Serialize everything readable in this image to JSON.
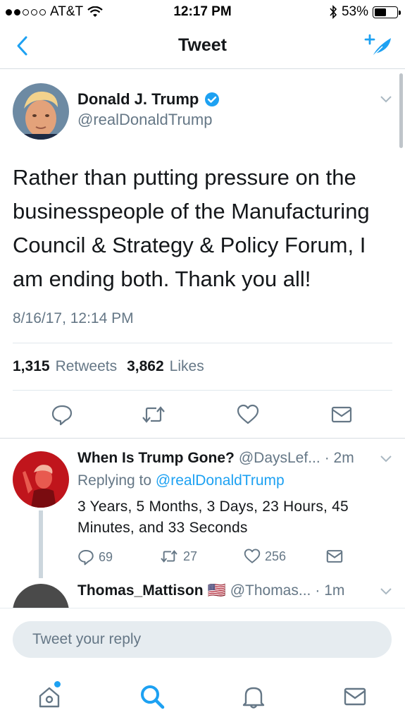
{
  "status_bar": {
    "carrier": "AT&T",
    "time": "12:17 PM",
    "battery_percent": "53%",
    "battery_level": 0.53
  },
  "nav": {
    "title": "Tweet"
  },
  "tweet": {
    "author_name": "Donald J. Trump",
    "author_handle": "@realDonaldTrump",
    "text": "Rather than putting pressure on the businesspeople of the Manufacturing Council & Strategy & Policy Forum, I am ending both. Thank you all!",
    "timestamp": "8/16/17, 12:14 PM",
    "retweets_count": "1,315",
    "retweets_label": "Retweets",
    "likes_count": "3,862",
    "likes_label": "Likes"
  },
  "replies": [
    {
      "name": "When Is Trump Gone?",
      "handle": "@DaysLef...",
      "age": "· 2m",
      "replying_prefix": "Replying to",
      "replying_to": "@realDonaldTrump",
      "text": "3 Years, 5 Months, 3 Days, 23 Hours, 45 Minutes, and 33 Seconds",
      "reply_count": "69",
      "retweet_count": "27",
      "like_count": "256"
    },
    {
      "name": "Thomas_Mattison",
      "flag": "🇺🇸",
      "handle": "@Thomas...",
      "age": "· 1m"
    }
  ],
  "composer": {
    "placeholder": "Tweet your reply"
  },
  "colors": {
    "accent": "#1da1f2",
    "secondary_text": "#657786",
    "primary_text": "#14171a"
  },
  "icons": [
    "back-chevron-icon",
    "compose-icon",
    "verified-icon",
    "chevron-down-icon",
    "reply-icon",
    "retweet-icon",
    "like-icon",
    "dm-icon",
    "home-icon",
    "search-icon",
    "notifications-icon",
    "messages-icon"
  ]
}
